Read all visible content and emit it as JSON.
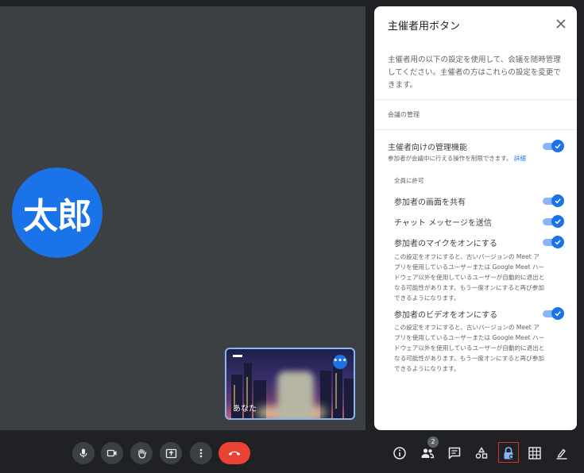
{
  "main": {
    "participant_initials": "太郎",
    "self_tile_name": "あなた"
  },
  "host_panel": {
    "title": "主催者用ボタン",
    "description": "主催者用の以下の設定を使用して、会議を随時管理してください。主催者の方はこれらの設定を変更できます。",
    "section_title": "会議の管理",
    "host_management": {
      "label": "主催者向けの管理機能",
      "sublabel": "参加者が会議中に行える操作を制限できます。",
      "link": "詳細",
      "enabled": true
    },
    "allow_all_heading": "全員に許可",
    "options": [
      {
        "label": "参加者の画面を共有",
        "enabled": true
      },
      {
        "label": "チャット メッセージを送信",
        "enabled": true
      },
      {
        "label": "参加者のマイクをオンにする",
        "enabled": true,
        "note": "この設定をオフにすると、古いバージョンの Meet アプリを使用しているユーザーまたは Google Meet ハードウェア以外を使用しているユーザーが自動的に退出となる可能性があります。もう一度オンにすると再び参加できるようになります。"
      },
      {
        "label": "参加者のビデオをオンにする",
        "enabled": true,
        "note": "この設定をオフにすると、古いバージョンの Meet アプリを使用しているユーザーまたは Google Meet ハードウェア以外を使用しているユーザーが自動的に退出となる可能性があります。もう一度オンにすると再び参加できるようになります。"
      }
    ]
  },
  "toolbar": {
    "participant_count": "2",
    "icons": [
      "mic-icon",
      "camera-icon",
      "raise-hand-icon",
      "present-icon",
      "more-options-icon",
      "end-call-icon",
      "info-icon",
      "people-icon",
      "chat-icon",
      "activities-icon",
      "host-controls-icon",
      "layout-grid-icon",
      "whiteboard-icon"
    ]
  },
  "colors": {
    "accent": "#1a73e8",
    "end_call": "#ea4335",
    "highlight": "#d93025"
  }
}
